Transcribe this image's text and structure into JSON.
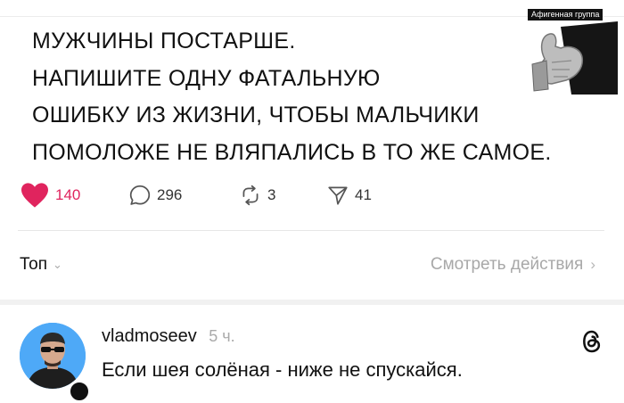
{
  "watermark": {
    "label": "Афигенная группа",
    "icon": "thumbs-up-hand"
  },
  "post": {
    "lines": [
      "МУЖЧИНЫ ПОСТАРШЕ.",
      "НАПИШИТЕ ОДНУ ФАТАЛЬНУЮ",
      "ОШИБКУ ИЗ ЖИЗНИ, ЧТОБЫ МАЛЬЧИКИ",
      "ПОМОЛОЖЕ НЕ ВЛЯПАЛИСЬ В ТО ЖЕ САМОЕ."
    ]
  },
  "actions": {
    "likes": "140",
    "comments": "296",
    "reposts": "3",
    "shares": "41",
    "like_color": "#e0245e"
  },
  "replies_header": {
    "sort_label": "Топ",
    "view_activity": "Смотреть действия"
  },
  "comment": {
    "username": "vladmoseev",
    "time": "5 ч.",
    "text": "Если шея солёная - ниже не спускайся.",
    "avatar_bg": "#4ea9f7"
  }
}
